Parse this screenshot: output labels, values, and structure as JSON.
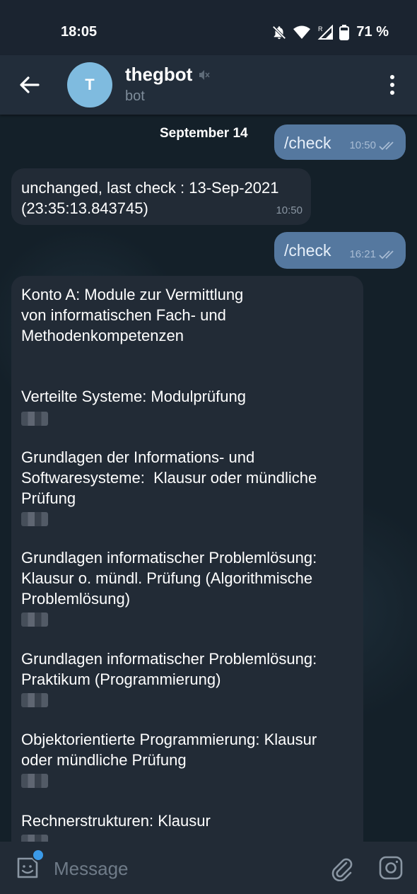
{
  "status_bar": {
    "time": "18:05",
    "battery_percent": "71 %",
    "icons": [
      "bell-off-icon",
      "wifi-icon",
      "roaming-signal-icon",
      "battery-icon"
    ]
  },
  "header": {
    "avatar_letter": "T",
    "title": "thegbot",
    "subtitle": "bot",
    "icons": [
      "back-arrow-icon",
      "muted-icon",
      "more-vert-icon"
    ]
  },
  "chat": {
    "date_label": "September 14",
    "messages": [
      {
        "direction": "out",
        "text": "/check",
        "time": "10:50",
        "read": true
      },
      {
        "direction": "in",
        "text": "unchanged, last check : 13-Sep-2021 (23:35:13.843745)",
        "time": "10:50"
      },
      {
        "direction": "out",
        "text": "/check",
        "time": "16:21",
        "read": true
      },
      {
        "direction": "in",
        "paragraphs": [
          "Konto A: Module zur Vermittlung\nvon informatischen Fach- und\nMethodenkompetenzen",
          "Verteilte Systeme: Modulprüfung",
          "Grundlagen der Informations- und\nSoftwaresysteme:  Klausur oder mündliche\nPrüfung",
          "Grundlagen informatischer Problemlösung:\nKlausur o. mündl. Prüfung (Algorithmische\nProblemlösung)",
          "Grundlagen informatischer Problemlösung:\nPraktikum (Programmierung)",
          "Objektorientierte Programmierung: Klausur\noder mündliche Prüfung",
          "Rechnerstrukturen: Klausur"
        ]
      }
    ]
  },
  "input_bar": {
    "placeholder": "Message",
    "icons": [
      "emoji-sticker-icon",
      "attach-icon",
      "camera-icon"
    ],
    "accent_dot_color": "#3b9ae8"
  },
  "colors": {
    "outgoing_bubble": "#55789f",
    "incoming_bubble": "#222b36",
    "header": "#222d3a",
    "avatar": "#7fbbdf"
  }
}
